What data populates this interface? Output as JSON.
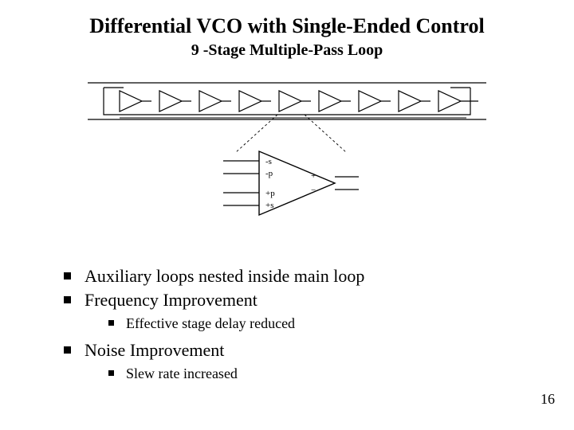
{
  "title": "Differential VCO with Single-Ended Control",
  "subtitle": "9 -Stage Multiple-Pass Loop",
  "delay_cell_labels": {
    "ns": "-s",
    "np": "-p",
    "pp": "+p",
    "ps": "+s",
    "plus": "+",
    "minus": "−"
  },
  "bullets": [
    {
      "text": "Auxiliary loops nested inside main loop",
      "sub": []
    },
    {
      "text": "Frequency Improvement",
      "sub": [
        "Effective stage delay reduced"
      ]
    },
    {
      "text": "Noise Improvement",
      "sub": [
        "Slew rate increased"
      ]
    }
  ],
  "page_number": "16"
}
